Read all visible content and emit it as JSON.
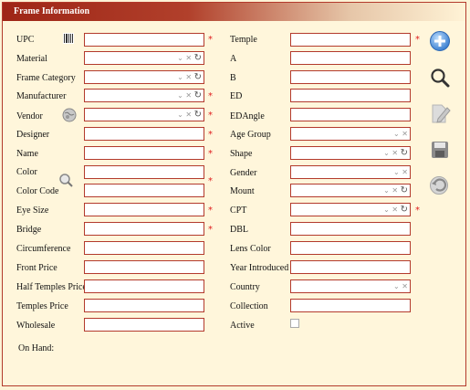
{
  "panel": {
    "title": "Frame Information"
  },
  "left": {
    "upc": "UPC",
    "material": "Material",
    "frame_category": "Frame Category",
    "manufacturer": "Manufacturer",
    "vendor": "Vendor",
    "designer": "Designer",
    "name": "Name",
    "color": "Color",
    "color_code": "Color Code",
    "eye_size": "Eye Size",
    "bridge": "Bridge",
    "circumference": "Circumference",
    "front_price": "Front Price",
    "half_temples_price": "Half Temples Price",
    "temples_price": "Temples Price",
    "wholesale": "Wholesale",
    "on_hand": "On Hand:"
  },
  "right": {
    "temple": "Temple",
    "a": "A",
    "b": "B",
    "ed": "ED",
    "ed_angle": "EDAngle",
    "age_group": "Age Group",
    "shape": "Shape",
    "gender": "Gender",
    "mount": "Mount",
    "cpt": "CPT",
    "dbl": "DBL",
    "lens_color": "Lens Color",
    "year_introduced": "Year Introduced",
    "country": "Country",
    "collection": "Collection",
    "active": "Active"
  },
  "required_mark": "*",
  "dropdown_glyphs": {
    "arrow": "⌄",
    "clear": "✕",
    "refresh": "↻"
  },
  "icons": [
    "barcode-icon",
    "globe-icon",
    "magnifier-icon",
    "add-icon",
    "search-icon",
    "edit-icon",
    "save-icon",
    "undo-icon"
  ],
  "colors": {
    "accent": "#b33a2c",
    "header_start": "#9e2516",
    "background": "#fff6db",
    "required": "#e02020"
  }
}
